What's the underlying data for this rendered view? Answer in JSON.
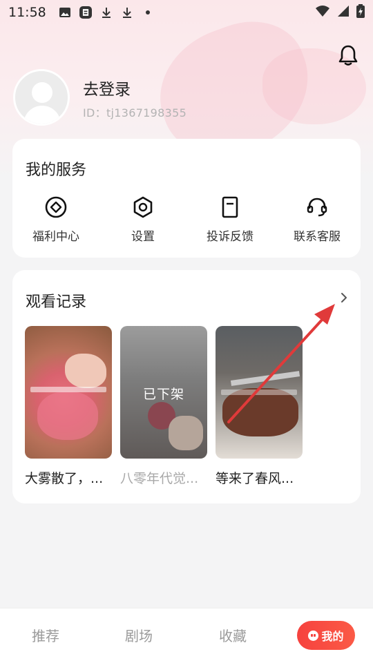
{
  "status_bar": {
    "time": "11:58",
    "icons": [
      "image-icon",
      "app-badge-icon",
      "download-icon",
      "download-icon",
      "dot-icon"
    ],
    "right_icons": [
      "wifi-icon",
      "signal-icon",
      "battery-charging-icon"
    ]
  },
  "header": {
    "login_label": "去登录",
    "user_id": "ID：tj1367198355",
    "bell_icon": "bell-icon"
  },
  "services": {
    "title": "我的服务",
    "items": [
      {
        "label": "福利中心",
        "icon": "diamond-circle-icon"
      },
      {
        "label": "设置",
        "icon": "hexagon-settings-icon"
      },
      {
        "label": "投诉反馈",
        "icon": "document-icon"
      },
      {
        "label": "联系客服",
        "icon": "headset-icon"
      }
    ]
  },
  "history": {
    "title": "观看记录",
    "more_icon": "chevron-right-icon",
    "videos": [
      {
        "title": "大雾散了，...",
        "removed": false
      },
      {
        "title": "八零年代觉...",
        "removed": true,
        "overlay": "已下架"
      },
      {
        "title": "等来了春风...",
        "removed": false
      }
    ]
  },
  "bottom_nav": {
    "items": [
      "推荐",
      "剧场",
      "收藏"
    ],
    "active": "我的"
  },
  "colors": {
    "accent": "#f6423e",
    "annotation_arrow": "#e03a3a"
  }
}
